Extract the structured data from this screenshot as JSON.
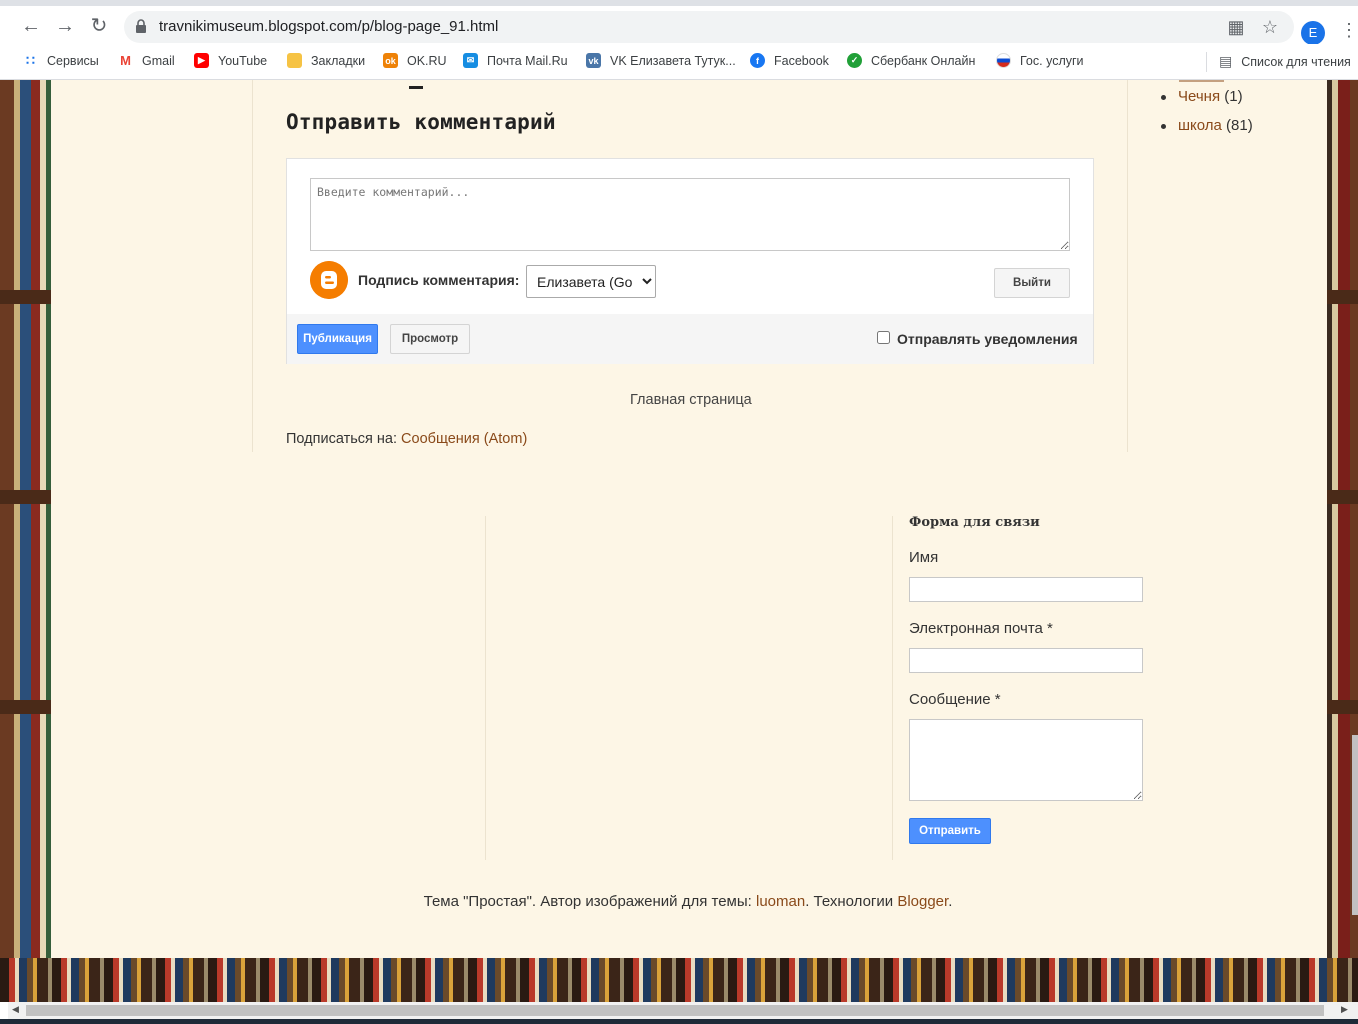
{
  "browser": {
    "url": "travnikimuseum.blogspot.com/p/blog-page_91.html",
    "profile_initial": "E",
    "bookmarks": [
      {
        "label": "Сервисы",
        "icon": "apps-grid-icon",
        "color": "#1a73e8"
      },
      {
        "label": "Gmail",
        "icon": "gmail-icon",
        "color": "#ea4335"
      },
      {
        "label": "YouTube",
        "icon": "youtube-icon",
        "color": "#ff0000"
      },
      {
        "label": "Закладки",
        "icon": "folder-icon",
        "color": "#f6c344"
      },
      {
        "label": "OK.RU",
        "icon": "odnoklassniki-icon",
        "color": "#ee8208"
      },
      {
        "label": "Почта Mail.Ru",
        "icon": "mail-icon",
        "color": "#168de2"
      },
      {
        "label": "VK Елизавета Тутук...",
        "icon": "vk-icon",
        "color": "#4a76a8"
      },
      {
        "label": "Facebook",
        "icon": "facebook-icon",
        "color": "#1877f2"
      },
      {
        "label": "Сбербанк Онлайн",
        "icon": "sberbank-icon",
        "color": "#21a038"
      },
      {
        "label": "Гос. услуги",
        "icon": "russian-flag-icon",
        "color": "#0d4cd3"
      }
    ],
    "reading_list": "Список для чтения"
  },
  "comments": {
    "heading": "Отправить комментарий",
    "placeholder": "Введите комментарий...",
    "signature_label": "Подпись комментария:",
    "identity": "Елизавета (Google)",
    "signout": "Выйти",
    "publish": "Публикация",
    "preview": "Просмотр",
    "notify": "Отправлять уведомления"
  },
  "nav": {
    "home": "Главная страница",
    "subscribe_prefix": "Подписаться на:",
    "subscribe_link": "Сообщения (Atom)"
  },
  "sidebar": {
    "labels": [
      {
        "name": "Чечня",
        "count": "(1)"
      },
      {
        "name": "школа",
        "count": "(81)"
      }
    ]
  },
  "contact_form": {
    "title": "Форма для связи",
    "name_label": "Имя",
    "email_label": "Электронная почта *",
    "message_label": "Сообщение *",
    "submit": "Отправить"
  },
  "footer": {
    "text1": "Тема \"Простая\". Автор изображений для темы: ",
    "author": "luoman",
    "text2": ". Технологии ",
    "platform": "Blogger",
    "text3": "."
  }
}
